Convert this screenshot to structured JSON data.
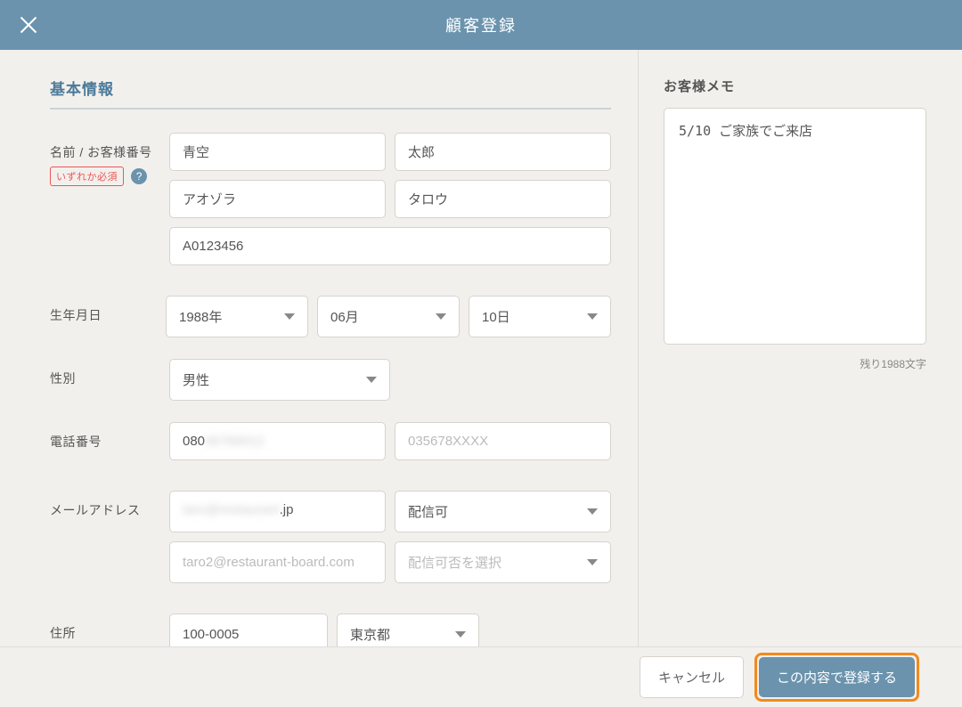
{
  "header": {
    "title": "顧客登録"
  },
  "section": {
    "basic": "基本情報",
    "memo": "お客様メモ"
  },
  "labels": {
    "name": "名前 / お客様番号",
    "required": "いずれか必須",
    "birthdate": "生年月日",
    "gender": "性別",
    "phone": "電話番号",
    "email": "メールアドレス",
    "address": "住所"
  },
  "name": {
    "last": "青空",
    "first": "太郎",
    "last_kana": "アオゾラ",
    "first_kana": "タロウ",
    "customer_no": "A0123456"
  },
  "birth": {
    "year": "1988年",
    "month": "06月",
    "day": "10日"
  },
  "gender": "男性",
  "phone": {
    "mobile_prefix": "080",
    "mobile_rest": "06789012",
    "landline_ph": "035678XXXX"
  },
  "email": {
    "value_blur": "taro@restaurant",
    "value_suffix": ".jp",
    "delivery1": "配信可",
    "placeholder2": "taro2@restaurant-board.com",
    "delivery2_ph": "配信可否を選択"
  },
  "address": {
    "postal": "100-0005",
    "pref": "東京都"
  },
  "memo": {
    "text": "5/10 ご家族でご来店",
    "counter": "残り1988文字"
  },
  "footer": {
    "cancel": "キャンセル",
    "submit": "この内容で登録する"
  }
}
